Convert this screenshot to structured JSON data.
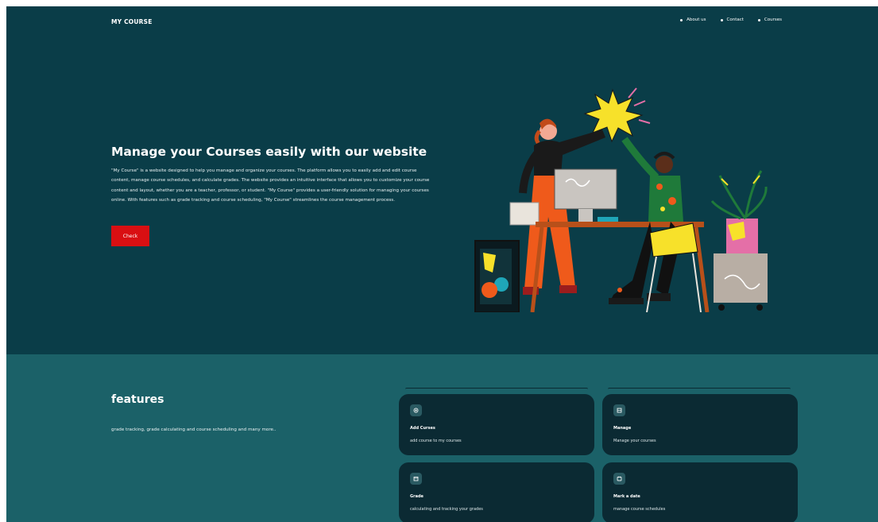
{
  "header": {
    "brand": "MY COURSE",
    "nav": [
      "About us",
      "Contact",
      "Courses"
    ]
  },
  "hero": {
    "title": "Manage your Courses easily with our website",
    "description": "\"My Course\" is a website designed to help you manage and organize your courses. The platform allows you to easily add and edit course content, manage course schedules, and calculate grades. The website provides an intuitive interface that allows you to customize your course content and layout, whether you are a teacher, professor, or student. \"My Course\" provides a user-friendly solution for managing your courses online. With features such as grade tracking and course scheduling, \"My Course\" streamlines the course management process.",
    "button_label": "Check"
  },
  "features": {
    "title": "features",
    "description": "grade tracking, grade calculating and course scheduling and many more..",
    "cards": [
      {
        "icon": "add-course-icon",
        "title": "Add Curses",
        "description": "add course to my courses"
      },
      {
        "icon": "manage-icon",
        "title": "Manage",
        "description": "Manage your courses"
      },
      {
        "icon": "calendar-icon",
        "title": "Grade",
        "description": "calculating and tracking your grades"
      },
      {
        "icon": "calendar-date-icon",
        "title": "Mark a date",
        "description": "manage course schedules"
      }
    ]
  },
  "colors": {
    "hero_bg": "#0a3d48",
    "features_bg": "#1b6168",
    "card_bg": "#0b2a33",
    "button": "#d90f12"
  }
}
